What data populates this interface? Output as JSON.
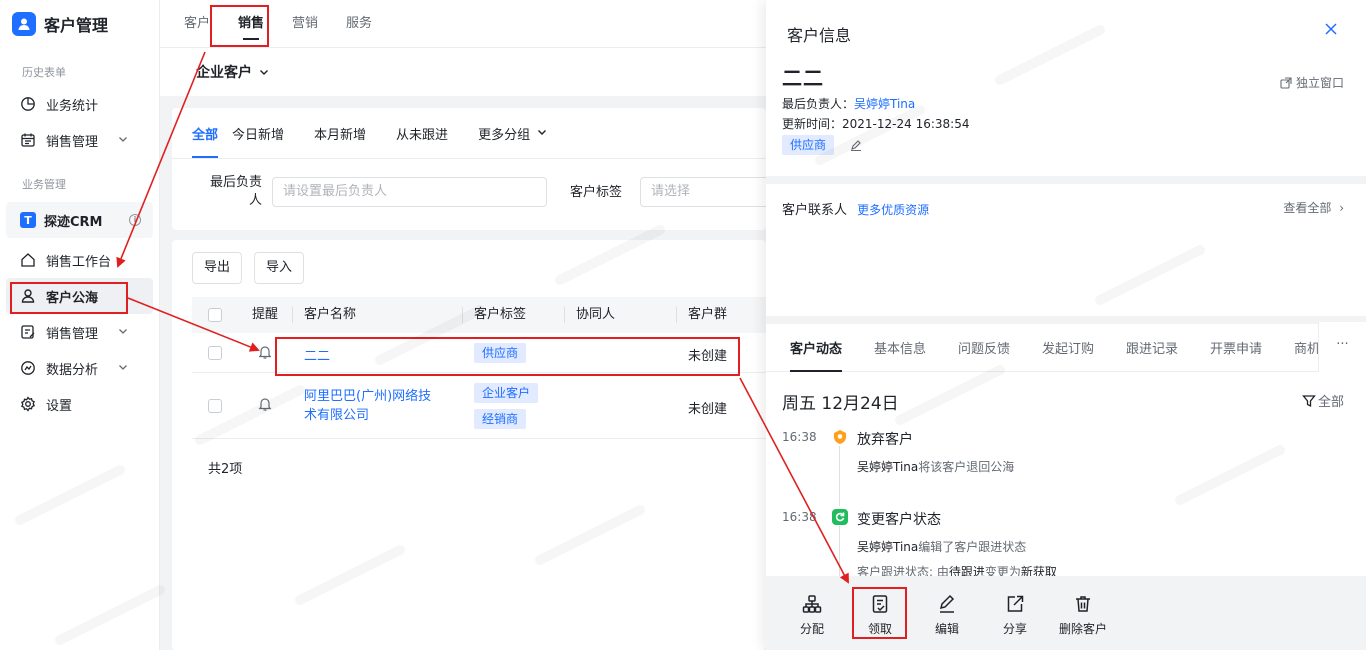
{
  "app": {
    "title": "客户管理"
  },
  "topnav": {
    "tabs": [
      "客户",
      "销售",
      "营销",
      "服务"
    ],
    "active": "销售"
  },
  "sidebar": {
    "group1": "历史表单",
    "item_stats": "业务统计",
    "item_sales_mgmt": "销售管理",
    "group2": "业务管理",
    "crm": "探迹CRM",
    "item_workbench": "销售工作台",
    "item_pool": "客户公海",
    "item_sales_mgmt2": "销售管理",
    "item_analysis": "数据分析",
    "item_settings": "设置"
  },
  "main": {
    "header": "企业客户",
    "filter_tabs": [
      "全部",
      "今日新增",
      "本月新增",
      "从未跟进",
      "更多分组"
    ],
    "owner_label_1": "最后负责",
    "owner_label_2": "人",
    "owner_placeholder": "请设置最后负责人",
    "tag_label": "客户标签",
    "tag_placeholder": "请选择",
    "export_btn": "导出",
    "import_btn": "导入",
    "columns": [
      "提醒",
      "客户名称",
      "客户标签",
      "协同人",
      "客户群"
    ],
    "rows": [
      {
        "name": "二二",
        "tag": "供应商",
        "group": "未创建"
      },
      {
        "name_line1": "阿里巴巴(广州)网络技",
        "name_line2": "术有限公司",
        "tag1": "企业客户",
        "tag2": "经销商",
        "group": "未创建"
      }
    ],
    "total": "共2项"
  },
  "drawer": {
    "title": "客户信息",
    "customer_name": "二二",
    "standalone": "独立窗口",
    "owner_label": "最后负责人：",
    "owner_value": "吴婷婷Tina",
    "updated_label": "更新时间：",
    "updated_value": "2021-12-24 16:38:54",
    "tag": "供应商",
    "contacts_title": "客户联系人",
    "contacts_link": "更多优质资源",
    "view_all": "查看全部",
    "tabs": [
      "客户动态",
      "基本信息",
      "问题反馈",
      "发起订购",
      "跟进记录",
      "开票申请",
      "商机"
    ],
    "more": "···",
    "date_header": "周五 12月24日",
    "filter_all": "全部",
    "timeline": [
      {
        "time": "16:38",
        "title": "放弃客户",
        "user": "吴婷婷Tina",
        "desc": "将该客户退回公海"
      },
      {
        "time": "16:38",
        "title": "变更客户状态",
        "user": "吴婷婷Tina",
        "desc": "编辑了客户跟进状态",
        "detail_prefix": "客户跟进状态: 由",
        "from": "待跟进",
        "mid": "变更为",
        "to": "新获取"
      }
    ],
    "footer": [
      "分配",
      "领取",
      "编辑",
      "分享",
      "删除客户"
    ]
  },
  "colors": {
    "accent": "#1e6fff",
    "highlight": "#e02020",
    "tag_bg": "#e1eaff",
    "tl_orange": "#ff9f1a",
    "tl_green": "#1fbd5d"
  }
}
